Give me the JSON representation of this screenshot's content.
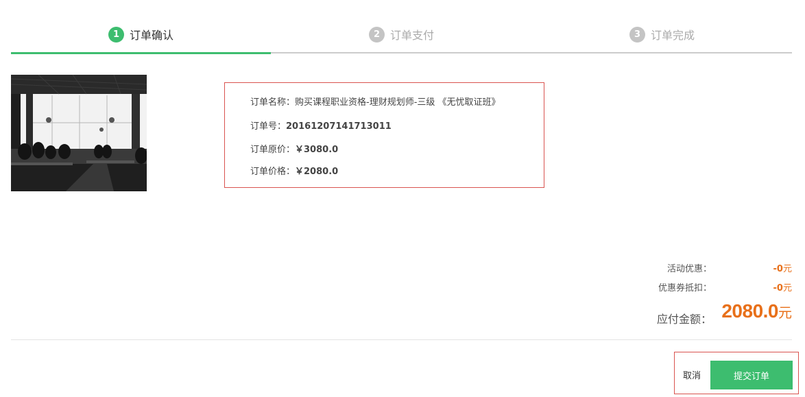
{
  "steps": [
    {
      "num": "1",
      "label": "订单确认",
      "state": "active"
    },
    {
      "num": "2",
      "label": "订单支付",
      "state": "inactive"
    },
    {
      "num": "3",
      "label": "订单完成",
      "state": "inactive"
    }
  ],
  "order": {
    "name_label": "订单名称：",
    "name_value": "购买课程职业资格-理财规划师-三级 《无忧取证班》",
    "number_label": "订单号：",
    "number_value": "20161207141713011",
    "original_price_label": "订单原价：",
    "original_price_value": "￥3080.0",
    "price_label": "订单价格：",
    "price_value": "￥2080.0"
  },
  "summary": {
    "activity_discount_label": "活动优惠：",
    "activity_discount_value": "-0",
    "coupon_label": "优惠券抵扣：",
    "coupon_value": "-0",
    "currency_unit": "元",
    "total_label": "应付金额：",
    "total_value": "2080.0"
  },
  "actions": {
    "cancel_label": "取消",
    "submit_label": "提交订单"
  },
  "colors": {
    "accent_green": "#3dbd6f",
    "price_orange": "#e8701a",
    "highlight_red": "#d9534f"
  }
}
